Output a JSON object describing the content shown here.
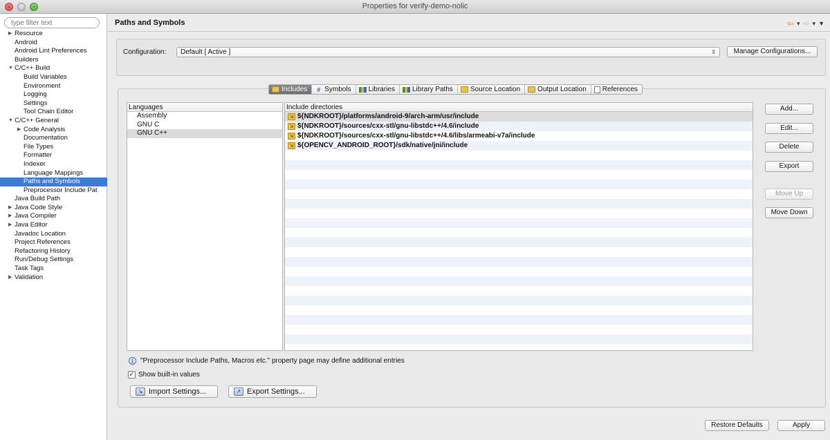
{
  "window": {
    "title": "Properties for verify-demo-nolic"
  },
  "filter": {
    "placeholder": "type filter text"
  },
  "tree": [
    {
      "label": "Resource",
      "level": 0,
      "twisty": "collapsed"
    },
    {
      "label": "Android",
      "level": 0
    },
    {
      "label": "Android Lint Preferences",
      "level": 0
    },
    {
      "label": "Builders",
      "level": 0
    },
    {
      "label": "C/C++ Build",
      "level": 0,
      "twisty": "expanded"
    },
    {
      "label": "Build Variables",
      "level": 1
    },
    {
      "label": "Environment",
      "level": 1
    },
    {
      "label": "Logging",
      "level": 1
    },
    {
      "label": "Settings",
      "level": 1
    },
    {
      "label": "Tool Chain Editor",
      "level": 1
    },
    {
      "label": "C/C++ General",
      "level": 0,
      "twisty": "expanded"
    },
    {
      "label": "Code Analysis",
      "level": 1,
      "twisty": "collapsed"
    },
    {
      "label": "Documentation",
      "level": 1
    },
    {
      "label": "File Types",
      "level": 1
    },
    {
      "label": "Formatter",
      "level": 1
    },
    {
      "label": "Indexer",
      "level": 1
    },
    {
      "label": "Language Mappings",
      "level": 1
    },
    {
      "label": "Paths and Symbols",
      "level": 1,
      "selected": true
    },
    {
      "label": "Preprocessor Include Pat",
      "level": 1
    },
    {
      "label": "Java Build Path",
      "level": 0
    },
    {
      "label": "Java Code Style",
      "level": 0,
      "twisty": "collapsed"
    },
    {
      "label": "Java Compiler",
      "level": 0,
      "twisty": "collapsed"
    },
    {
      "label": "Java Editor",
      "level": 0,
      "twisty": "collapsed"
    },
    {
      "label": "Javadoc Location",
      "level": 0
    },
    {
      "label": "Project References",
      "level": 0
    },
    {
      "label": "Refactoring History",
      "level": 0
    },
    {
      "label": "Run/Debug Settings",
      "level": 0
    },
    {
      "label": "Task Tags",
      "level": 0
    },
    {
      "label": "Validation",
      "level": 0,
      "twisty": "collapsed"
    }
  ],
  "page": {
    "title": "Paths and Symbols"
  },
  "config": {
    "label": "Configuration:",
    "value": "Default  [ Active ]",
    "manage_label": "Manage Configurations..."
  },
  "tabs": [
    {
      "label": "Includes",
      "icon": "folder-include-icon",
      "active": true
    },
    {
      "label": "Symbols",
      "icon": "hash-icon"
    },
    {
      "label": "Libraries",
      "icon": "library-icon"
    },
    {
      "label": "Library Paths",
      "icon": "library-path-icon"
    },
    {
      "label": "Source Location",
      "icon": "source-location-icon"
    },
    {
      "label": "Output Location",
      "icon": "output-location-icon"
    },
    {
      "label": "References",
      "icon": "references-icon"
    }
  ],
  "languages": {
    "header": "Languages",
    "items": [
      {
        "label": "Assembly"
      },
      {
        "label": "GNU C"
      },
      {
        "label": "GNU C++",
        "selected": true
      }
    ]
  },
  "includes": {
    "header": "Include directories",
    "items": [
      {
        "path": "${NDKROOT}/platforms/android-9/arch-arm/usr/include",
        "selected": true
      },
      {
        "path": "${NDKROOT}/sources/cxx-stl/gnu-libstdc++/4.6/include"
      },
      {
        "path": "${NDKROOT}/sources/cxx-stl/gnu-libstdc++/4.6/libs/armeabi-v7a/include"
      },
      {
        "path": "${OPENCV_ANDROID_ROOT}/sdk/native/jni/include"
      }
    ]
  },
  "side_buttons": {
    "add": "Add...",
    "edit": "Edit...",
    "delete": "Delete",
    "export": "Export",
    "move_up": "Move Up",
    "move_down": "Move Down"
  },
  "info_text": "\"Preprocessor Include Paths, Macros etc.\" property page may define additional entries",
  "show_builtin": {
    "label": "Show built-in values",
    "checked": true
  },
  "import_label": "Import Settings...",
  "export_label": "Export Settings...",
  "footer": {
    "restore_label": "Restore Defaults",
    "apply_label": "Apply"
  },
  "colors": {
    "selection": "#3d7bd8",
    "stripe": "#eef3fa",
    "folder": "#f0c24a"
  }
}
